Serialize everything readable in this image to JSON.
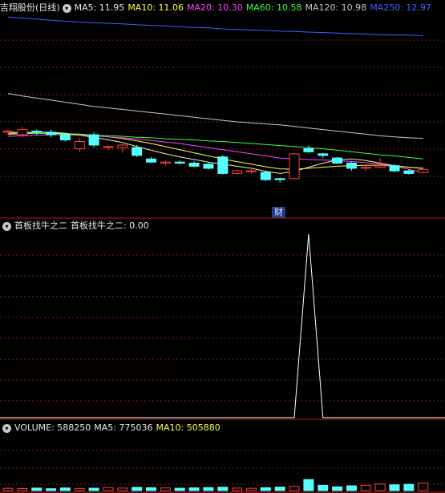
{
  "main_header": {
    "stock": "吉翔股份(日线)",
    "indicators": [
      {
        "label": "MA5: 11.95",
        "color": "#e8e8e8"
      },
      {
        "label": "MA10: 11.06",
        "color": "#ffff40"
      },
      {
        "label": "MA20: 10.30",
        "color": "#ff40ff"
      },
      {
        "label": "MA60: 10.58",
        "color": "#40ff40"
      },
      {
        "label": "MA120: 10.98",
        "color": "#c8c8c8"
      },
      {
        "label": "MA250: 12.97",
        "color": "#4060ff"
      }
    ]
  },
  "event_marker": "财",
  "indicator_header": {
    "name": "首板找牛之二",
    "value_label": "首板找牛之二: 0.00"
  },
  "volume_header": {
    "items": [
      {
        "label": "VOLUME: 588250",
        "color": "#e8e8e8"
      },
      {
        "label": "MA5: 775036",
        "color": "#e8e8e8"
      },
      {
        "label": "MA10: 505880",
        "color": "#ffff40"
      }
    ]
  },
  "colors": {
    "up": "#ff4040",
    "down": "#54ffff",
    "grid": "#8b1a1a",
    "separator": "#b01818"
  },
  "chart_data": [
    {
      "type": "candlestick",
      "candles": [
        {
          "o": 11.1,
          "c": 11.12,
          "h": 11.15,
          "l": 11.05
        },
        {
          "o": 11.05,
          "c": 11.15,
          "h": 11.2,
          "l": 11.0
        },
        {
          "o": 11.12,
          "c": 11.1,
          "h": 11.15,
          "l": 11.05
        },
        {
          "o": 11.1,
          "c": 11.05,
          "h": 11.15,
          "l": 11.0
        },
        {
          "o": 11.05,
          "c": 10.95,
          "h": 11.08,
          "l": 10.92
        },
        {
          "o": 10.78,
          "c": 10.92,
          "h": 10.98,
          "l": 10.72
        },
        {
          "o": 11.05,
          "c": 10.85,
          "h": 11.1,
          "l": 10.8
        },
        {
          "o": 10.82,
          "c": 10.82,
          "h": 10.85,
          "l": 10.75
        },
        {
          "o": 10.8,
          "c": 10.85,
          "h": 10.88,
          "l": 10.7
        },
        {
          "o": 10.8,
          "c": 10.65,
          "h": 10.85,
          "l": 10.62
        },
        {
          "o": 10.58,
          "c": 10.52,
          "h": 10.62,
          "l": 10.5
        },
        {
          "o": 10.5,
          "c": 10.52,
          "h": 10.55,
          "l": 10.45
        },
        {
          "o": 10.52,
          "c": 10.5,
          "h": 10.55,
          "l": 10.47
        },
        {
          "o": 10.5,
          "c": 10.44,
          "h": 10.54,
          "l": 10.42
        },
        {
          "o": 10.48,
          "c": 10.4,
          "h": 10.52,
          "l": 10.38
        },
        {
          "o": 10.62,
          "c": 10.3,
          "h": 10.65,
          "l": 10.28
        },
        {
          "o": 10.3,
          "c": 10.35,
          "h": 10.38,
          "l": 10.28
        },
        {
          "o": 10.35,
          "c": 10.35,
          "h": 10.38,
          "l": 10.3
        },
        {
          "o": 10.32,
          "c": 10.18,
          "h": 10.36,
          "l": 10.15
        },
        {
          "o": 10.2,
          "c": 10.18,
          "h": 10.22,
          "l": 10.12
        },
        {
          "o": 10.2,
          "c": 10.68,
          "h": 10.7,
          "l": 10.18
        },
        {
          "o": 10.78,
          "c": 10.72,
          "h": 10.84,
          "l": 10.7
        },
        {
          "o": 10.68,
          "c": 10.65,
          "h": 10.7,
          "l": 10.6
        },
        {
          "o": 10.6,
          "c": 10.5,
          "h": 10.62,
          "l": 10.48
        },
        {
          "o": 10.5,
          "c": 10.4,
          "h": 10.52,
          "l": 10.35
        },
        {
          "o": 10.4,
          "c": 10.42,
          "h": 10.45,
          "l": 10.35
        },
        {
          "o": 10.42,
          "c": 10.45,
          "h": 10.6,
          "l": 10.4
        },
        {
          "o": 10.45,
          "c": 10.35,
          "h": 10.48,
          "l": 10.32
        },
        {
          "o": 10.35,
          "c": 10.3,
          "h": 10.38,
          "l": 10.28
        },
        {
          "o": 10.32,
          "c": 10.38,
          "h": 10.4,
          "l": 10.3
        }
      ],
      "ylim": [
        9.7,
        13.35
      ],
      "ma_lines": [
        {
          "name": "MA5",
          "color": "#f0f0a0",
          "values": [
            11.08,
            11.09,
            11.1,
            11.1,
            11.08,
            11.04,
            11.0,
            10.95,
            10.9,
            10.82,
            10.75,
            10.68,
            10.62,
            10.57,
            10.52,
            10.48,
            10.44,
            10.4,
            10.34,
            10.3,
            10.34,
            10.42,
            10.5,
            10.56,
            10.58,
            10.55,
            10.5,
            10.45,
            10.42,
            10.4
          ]
        },
        {
          "name": "MA10",
          "color": "#ffff40",
          "values": [
            11.06,
            11.07,
            11.08,
            11.08,
            11.07,
            11.06,
            11.04,
            11.01,
            10.98,
            10.93,
            10.88,
            10.82,
            10.76,
            10.7,
            10.64,
            10.58,
            10.53,
            10.48,
            10.43,
            10.39,
            10.38,
            10.4,
            10.42,
            10.44,
            10.45,
            10.46,
            10.46,
            10.44,
            10.42,
            10.4
          ]
        },
        {
          "name": "MA20",
          "color": "#ff40ff",
          "values": [
            11.02,
            11.03,
            11.04,
            11.05,
            11.05,
            11.04,
            11.03,
            11.01,
            10.99,
            10.97,
            10.94,
            10.91,
            10.88,
            10.84,
            10.8,
            10.76,
            10.72,
            10.68,
            10.64,
            10.6,
            10.58,
            10.57,
            10.56,
            10.55,
            10.53,
            10.51,
            10.48,
            10.44,
            10.38,
            10.32
          ]
        },
        {
          "name": "MA60",
          "color": "#40ff40",
          "values": [
            11.1,
            11.09,
            11.08,
            11.07,
            11.06,
            11.05,
            11.04,
            11.03,
            11.02,
            11.0,
            10.99,
            10.97,
            10.96,
            10.95,
            10.93,
            10.92,
            10.9,
            10.88,
            10.86,
            10.84,
            10.82,
            10.8,
            10.78,
            10.75,
            10.72,
            10.69,
            10.66,
            10.64,
            10.61,
            10.58
          ]
        },
        {
          "name": "MA120",
          "color": "#c8c8c8",
          "values": [
            11.85,
            11.8,
            11.76,
            11.72,
            11.68,
            11.64,
            11.6,
            11.57,
            11.54,
            11.51,
            11.48,
            11.45,
            11.42,
            11.39,
            11.36,
            11.33,
            11.3,
            11.28,
            11.26,
            11.24,
            11.21,
            11.18,
            11.15,
            11.12,
            11.09,
            11.06,
            11.03,
            11.01,
            10.99,
            10.98
          ]
        },
        {
          "name": "MA250",
          "color": "#4060ff",
          "values": [
            13.33,
            13.31,
            13.29,
            13.27,
            13.25,
            13.23,
            13.22,
            13.21,
            13.2,
            13.18,
            13.17,
            13.16,
            13.14,
            13.13,
            13.12,
            13.1,
            13.09,
            13.08,
            13.07,
            13.06,
            13.05,
            13.04,
            13.03,
            13.02,
            13.01,
            13.0,
            12.99,
            12.98,
            12.98,
            12.97
          ]
        }
      ]
    },
    {
      "type": "line",
      "name": "首板找牛之二",
      "values": [
        0,
        0,
        0,
        0,
        0,
        0,
        0,
        0,
        0,
        0,
        0,
        0,
        0,
        0,
        0,
        0,
        0,
        0,
        0,
        0,
        0,
        1,
        0,
        0,
        0,
        0,
        0,
        0,
        0,
        0
      ],
      "ylim": [
        0,
        1
      ]
    },
    {
      "type": "bar",
      "name": "VOLUME",
      "values": [
        180000,
        160000,
        200000,
        150000,
        210000,
        170000,
        190000,
        240000,
        200000,
        260000,
        230000,
        210000,
        190000,
        220000,
        240000,
        270000,
        200000,
        180000,
        230000,
        280000,
        340000,
        880000,
        420000,
        300000,
        380000,
        420000,
        520000,
        460000,
        500000,
        588250
      ],
      "ylim": [
        0,
        4400000
      ]
    }
  ]
}
